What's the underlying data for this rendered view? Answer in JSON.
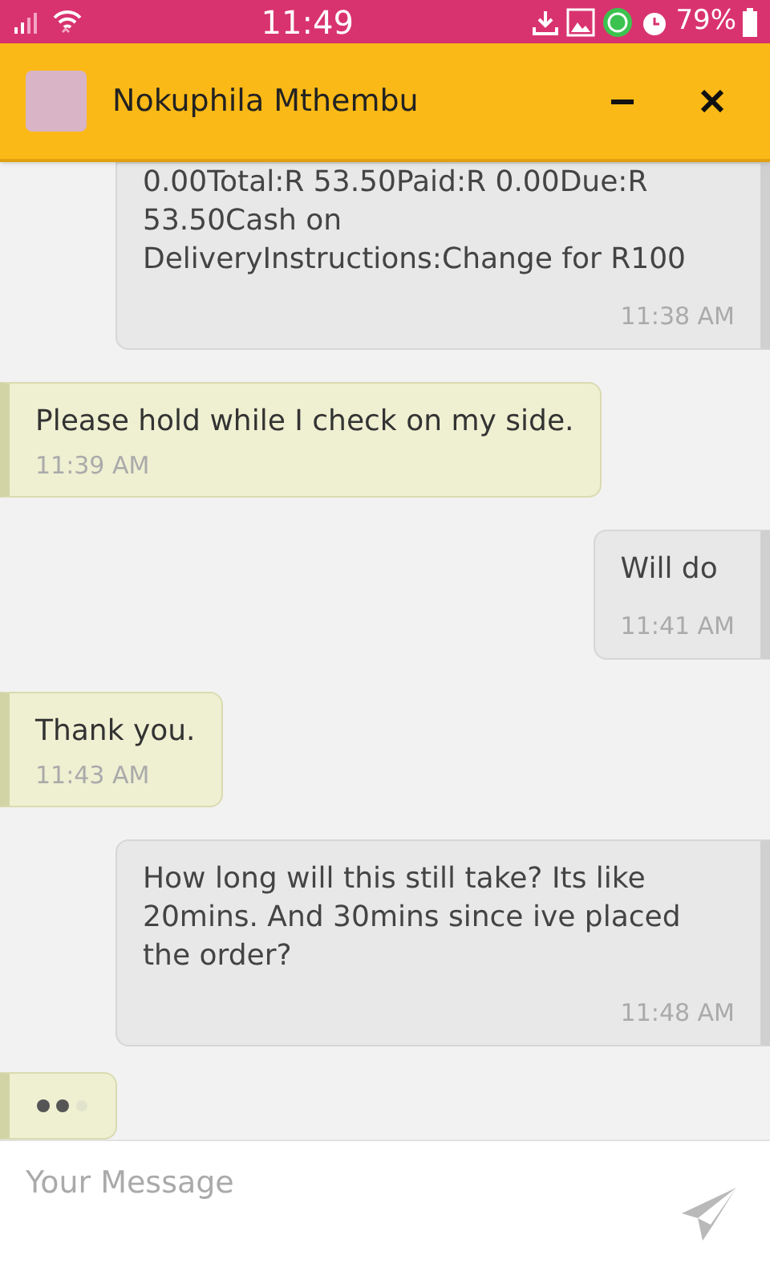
{
  "status_bar": {
    "time": "11:49",
    "battery": "79%"
  },
  "header": {
    "contact_name": "Nokuphila Mthembu"
  },
  "messages": [
    {
      "kind": "outgoing",
      "text": "0.00Total:R 53.50Paid:R 0.00Due:R 53.50Cash on DeliveryInstructions:Change for R100",
      "time": "11:38 AM"
    },
    {
      "kind": "incoming",
      "text": "Please hold while I check on my side.",
      "time": "11:39 AM"
    },
    {
      "kind": "outgoing",
      "text": "Will do",
      "time": "11:41 AM"
    },
    {
      "kind": "incoming",
      "text": "Thank you.",
      "time": "11:43 AM"
    },
    {
      "kind": "outgoing",
      "text": "How long will this still take? Its like 20mins. And 30mins since ive placed the order?",
      "time": "11:48 AM"
    }
  ],
  "typing_indicator": true,
  "composer": {
    "placeholder": "Your Message"
  }
}
